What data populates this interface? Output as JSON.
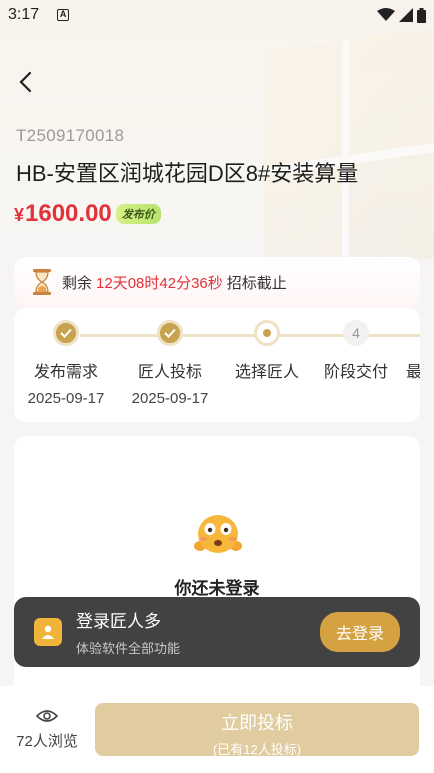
{
  "status_bar": {
    "time": "3:17",
    "notif_icon": "A"
  },
  "task": {
    "number": "T2509170018",
    "title": "HB-安置区润城花园D区8#安装算量",
    "price_currency": "¥",
    "price_value": "1600.00",
    "price_tag": "发布价"
  },
  "countdown": {
    "prefix": "剩余",
    "remaining": "12天08时42分36秒",
    "suffix": "招标截止"
  },
  "steps": [
    {
      "label": "发布需求",
      "date": "2025-09-17",
      "state": "done"
    },
    {
      "label": "匠人投标",
      "date": "2025-09-17",
      "state": "done"
    },
    {
      "label": "选择匠人",
      "date": "",
      "state": "current"
    },
    {
      "label": "阶段交付",
      "date": "",
      "state": "todo",
      "number": "4"
    },
    {
      "label": "最",
      "date": "",
      "state": "todo"
    }
  ],
  "login_prompt": {
    "text": "你还未登录"
  },
  "toast": {
    "title": "登录匠人多",
    "subtitle": "体验软件全部功能",
    "button": "去登录"
  },
  "bottom": {
    "views": "72人浏览",
    "bid_label": "立即投标",
    "bid_sub": "(已有12人投标)"
  },
  "colors": {
    "accent": "#c7a24f",
    "price": "#e2323a",
    "button_disabled": "#e0cc9f"
  }
}
